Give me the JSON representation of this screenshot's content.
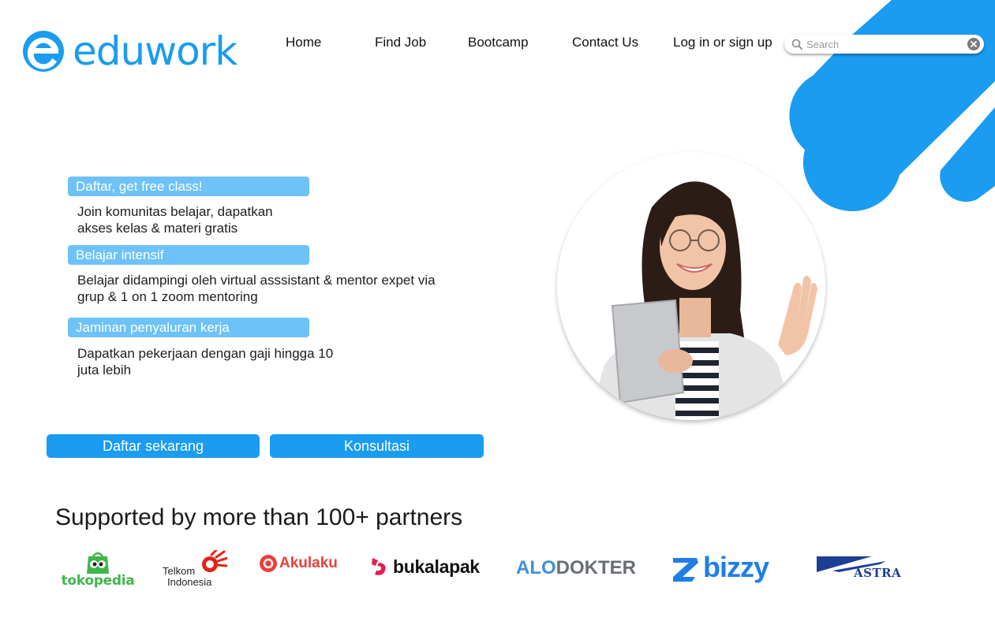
{
  "brand": {
    "name": "eduwork",
    "color": "#1a9cf0"
  },
  "nav": {
    "items": [
      "Home",
      "Find Job",
      "Bootcamp",
      "Contact Us",
      "Log in or sign up"
    ]
  },
  "search": {
    "placeholder": "Search",
    "value": ""
  },
  "features": [
    {
      "title": "Daftar, get free class!",
      "lines": [
        "Join komunitas belajar, dapatkan",
        "akses kelas & materi gratis"
      ]
    },
    {
      "title": "Belajar intensif",
      "lines": [
        "Belajar didampingi oleh virtual asssistant & mentor expet via",
        "grup & 1 on 1 zoom mentoring"
      ]
    },
    {
      "title": "Jaminan penyaluran kerja",
      "lines": [
        "Dapatkan pekerjaan dengan gaji hingga 10",
        "juta lebih"
      ]
    }
  ],
  "buttons": {
    "primary": "Daftar sekarang",
    "secondary": "Konsultasi"
  },
  "partners": {
    "title": "Supported by more than 100+ partners",
    "tokopedia": "tokopedia",
    "telkom_line1": "Telkom",
    "telkom_line2": "Indonesia",
    "akulaku": "Akulaku",
    "bukalapak": "bukalapak",
    "alodokter_a": "ALO",
    "alodokter_b": "DOKTER",
    "bizzy": "bizzy",
    "astra": "ASTRA"
  },
  "colors": {
    "accent": "#1a9cf0",
    "feature_title_bg": "#6dc2f8",
    "tokopedia": "#42b549",
    "telkom": "#e42313",
    "akulaku": "#e8413a",
    "bukalapak": "#e31e52",
    "alodokter": "#3e8fdc",
    "bizzy": "#1e7fe6",
    "astra": "#1c3f94"
  }
}
